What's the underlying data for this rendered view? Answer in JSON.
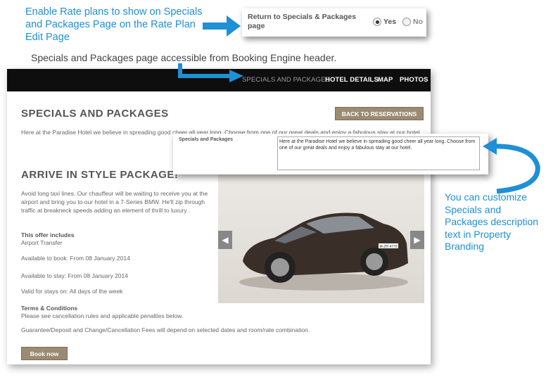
{
  "callouts": {
    "rate_plan": "Enable Rate plans to show on Specials and Packages Page on the Rate Plan Edit Page",
    "header_access": "Specials and Packages page accessible from Booking Engine header.",
    "customize": "You can customize Specials and Packages description text in Property Branding"
  },
  "rate_plan_field": {
    "label": "Return to Specials & Packages page",
    "options": [
      "Yes",
      "No"
    ],
    "selected": "Yes"
  },
  "nav": {
    "items": [
      "SPECIALS AND PACKAGES",
      "HOTEL DETAILS",
      "MAP",
      "PHOTOS"
    ],
    "active": "SPECIALS AND PACKAGES"
  },
  "page": {
    "title": "SPECIALS AND PACKAGES",
    "back_button": "BACK TO RESERVATIONS",
    "intro": "Here at the Paradise Hotel we believe in spreading good cheer all year long. Choose from one of our great deals and enjoy a fabulous stay at our hotel."
  },
  "package": {
    "title": "ARRIVE IN STYLE PACKAGE!",
    "description": "Avoid long taxi lines. Our chauffeur will be waiting to receive you at the airport and bring you to our hotel in a 7-Series BMW. He'll zip through traffic at breakneck speeds adding an element of thrill to luxury .",
    "includes_heading": "This offer includes",
    "includes_item": "Airport Transfer",
    "available_book": "Available to book: From 08 January 2014",
    "available_stay": "Available to stay: From 08 January 2014",
    "valid": "Valid for stays on: All days of the week",
    "terms_heading": "Terms & Conditions",
    "terms_text": "Please see cancellation rules and applicable penalties below.",
    "guarantee": "Guarantee/Deposit and Change/Cancellation Fees will depend on selected dates and room/rate combination.",
    "book_button": "Book now",
    "car_plate": "M-ZH 4770"
  },
  "branding_field": {
    "label": "Specials and Packages",
    "value": "Here at the Paradise Hotel we believe in spreading good cheer all year long. Choose from one of our great deals and enjoy a fabulous stay at our hotel."
  },
  "colors": {
    "callout_blue": "#1f8fd6",
    "button_tan": "#9b8b73",
    "nav_black": "#0e0e0e"
  }
}
